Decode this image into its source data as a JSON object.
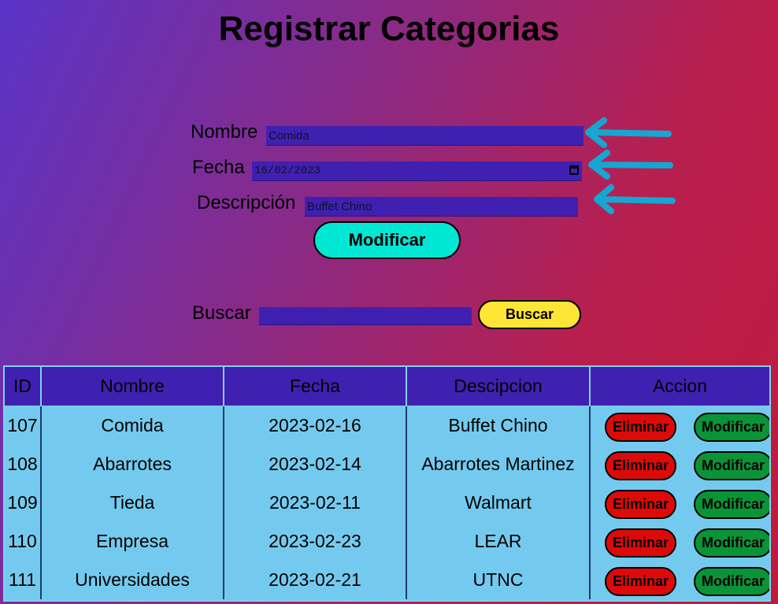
{
  "title": "Registrar Categorias",
  "form": {
    "nombre_label": "Nombre",
    "nombre_value": "Comida",
    "fecha_label": "Fecha",
    "fecha_value": "16/02/2023",
    "descripcion_label": "Descripción",
    "descripcion_value": "Buffet Chino",
    "submit_label": "Modificar"
  },
  "search": {
    "label": "Buscar",
    "value": "",
    "button_label": "Buscar"
  },
  "table": {
    "headers": [
      "ID",
      "Nombre",
      "Fecha",
      "Descipcion",
      "Accion"
    ],
    "rows": [
      {
        "id": "107",
        "nombre": "Comida",
        "fecha": "2023-02-16",
        "descripcion": "Buffet Chino",
        "eliminar": "Eliminar",
        "modificar": "Modificar"
      },
      {
        "id": "108",
        "nombre": "Abarrotes",
        "fecha": "2023-02-14",
        "descripcion": "Abarrotes Martinez",
        "eliminar": "Eliminar",
        "modificar": "Modificar"
      },
      {
        "id": "109",
        "nombre": "Tieda",
        "fecha": "2023-02-11",
        "descripcion": "Walmart",
        "eliminar": "Eliminar",
        "modificar": "Modificar"
      },
      {
        "id": "110",
        "nombre": "Empresa",
        "fecha": "2023-02-23",
        "descripcion": "LEAR",
        "eliminar": "Eliminar",
        "modificar": "Modificar"
      },
      {
        "id": "111",
        "nombre": "Universidades",
        "fecha": "2023-02-21",
        "descripcion": "UTNC",
        "eliminar": "Eliminar",
        "modificar": "Modificar"
      }
    ]
  },
  "colors": {
    "input_bg": "#4020b0",
    "modificar_primary": "#00e8d4",
    "buscar": "#ffe535",
    "eliminar": "#dd0a0a",
    "modificar_row": "#0a9438",
    "table_bg": "#74caee",
    "arrow": "#16a6d2"
  },
  "icons": {
    "arrows": "arrow-left-icon",
    "calendar": "calendar-icon"
  }
}
